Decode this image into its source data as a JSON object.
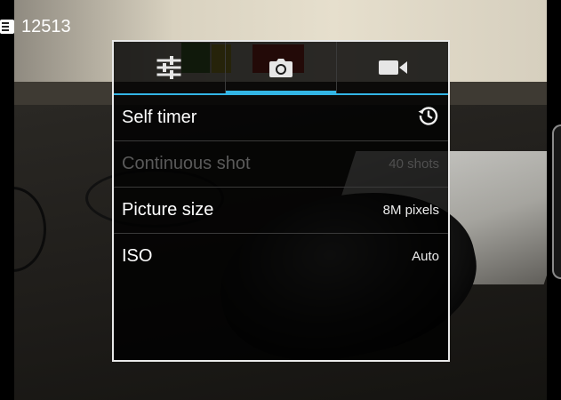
{
  "status_bar": {
    "remaining_shots": "12513",
    "sim_icon": "sim-card-icon"
  },
  "panel": {
    "tabs": [
      {
        "icon": "sliders-icon",
        "active": false
      },
      {
        "icon": "camera-icon",
        "active": true
      },
      {
        "icon": "video-camera-icon",
        "active": false
      }
    ],
    "rows": [
      {
        "label": "Self timer",
        "value_icon": "timer-icon",
        "enabled": true
      },
      {
        "label": "Continuous shot",
        "value": "40 shots",
        "enabled": false
      },
      {
        "label": "Picture size",
        "value": "8M pixels",
        "enabled": true
      },
      {
        "label": "ISO",
        "value": "Auto",
        "enabled": true
      }
    ]
  },
  "colors": {
    "accent": "#33b5e5",
    "panel_border": "#e9e9e9"
  }
}
